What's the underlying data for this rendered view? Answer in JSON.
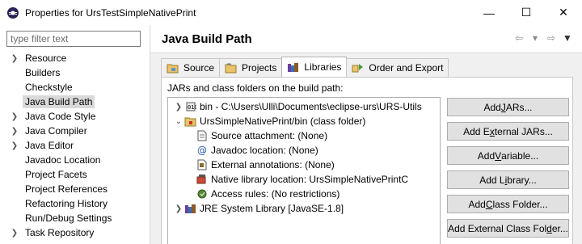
{
  "window": {
    "title": "Properties for UrsTestSimpleNativePrint",
    "minimize": "—",
    "maximize": "☐",
    "close": "✕"
  },
  "filter": {
    "placeholder": "type filter text",
    "value": ""
  },
  "nav": {
    "items": [
      {
        "label": "Resource",
        "expandable": true
      },
      {
        "label": "Builders",
        "expandable": false
      },
      {
        "label": "Checkstyle",
        "expandable": false
      },
      {
        "label": "Java Build Path",
        "expandable": false,
        "selected": true
      },
      {
        "label": "Java Code Style",
        "expandable": true
      },
      {
        "label": "Java Compiler",
        "expandable": true
      },
      {
        "label": "Java Editor",
        "expandable": true
      },
      {
        "label": "Javadoc Location",
        "expandable": false
      },
      {
        "label": "Project Facets",
        "expandable": false
      },
      {
        "label": "Project References",
        "expandable": false
      },
      {
        "label": "Refactoring History",
        "expandable": false
      },
      {
        "label": "Run/Debug Settings",
        "expandable": false
      },
      {
        "label": "Task Repository",
        "expandable": true
      }
    ]
  },
  "page": {
    "title": "Java Build Path"
  },
  "tabs": [
    {
      "label": "Source",
      "icon": "source-folder-icon"
    },
    {
      "label": "Projects",
      "icon": "projects-icon"
    },
    {
      "label": "Libraries",
      "icon": "libraries-icon",
      "active": true
    },
    {
      "label": "Order and Export",
      "icon": "order-export-icon"
    }
  ],
  "libraries": {
    "label": "JARs and class folders on the build path:",
    "tree": [
      {
        "text": "bin - C:\\Users\\Ulli\\Documents\\eclipse-urs\\URS-Utils",
        "icon": "binary-folder-icon",
        "chevron": "collapsed",
        "level": 0
      },
      {
        "text": "UrsSimpleNativePrint/bin (class folder)",
        "icon": "class-folder-icon",
        "chevron": "expanded",
        "level": 0
      },
      {
        "text": "Source attachment: (None)",
        "icon": "source-attachment-icon",
        "level": 1
      },
      {
        "text": "Javadoc location: (None)",
        "icon": "javadoc-icon",
        "level": 1
      },
      {
        "text": "External annotations: (None)",
        "icon": "annotations-icon",
        "level": 1
      },
      {
        "text": "Native library location: UrsSimpleNativePrintC",
        "icon": "native-library-icon",
        "level": 1
      },
      {
        "text": "Access rules: (No restrictions)",
        "icon": "access-rules-icon",
        "level": 1
      },
      {
        "text": "JRE System Library [JavaSE-1.8]",
        "icon": "jre-library-icon",
        "chevron": "collapsed",
        "level": 0
      }
    ],
    "buttons": [
      {
        "label": "Add JARs...",
        "mnemonic": "J"
      },
      {
        "label": "Add External JARs...",
        "mnemonic": "x"
      },
      {
        "label": "Add Variable...",
        "mnemonic": "V"
      },
      {
        "label": "Add Library...",
        "mnemonic": "i"
      },
      {
        "label": "Add Class Folder...",
        "mnemonic": "C"
      },
      {
        "label": "Add External Class Folder...",
        "mnemonic": "d"
      }
    ]
  },
  "colors": {
    "selection": "#d9d9d9",
    "panel_bg": "#f0f0f0",
    "button_bg": "#e1e1e1",
    "button_border": "#adadad"
  }
}
